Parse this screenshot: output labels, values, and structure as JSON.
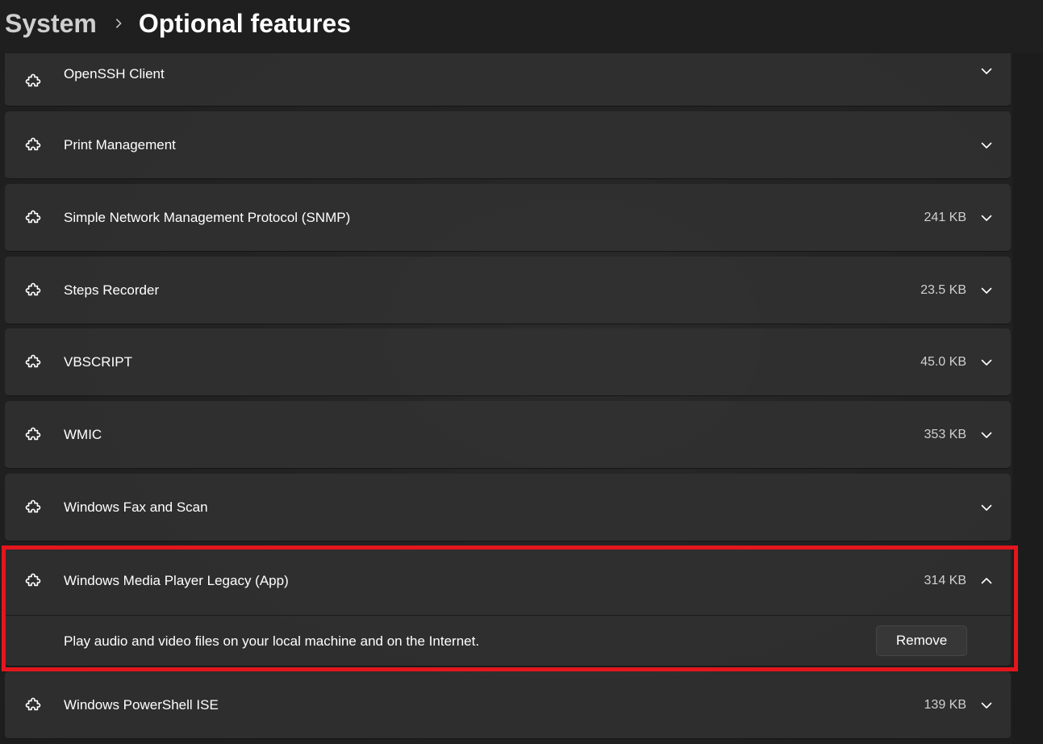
{
  "breadcrumb": {
    "parent": "System",
    "current": "Optional features"
  },
  "icons": {
    "feature": "puzzle-piece-icon",
    "expand": "chevron-down-icon",
    "collapse": "chevron-up-icon",
    "separator": "chevron-right-icon"
  },
  "colors": {
    "highlight": "#e3161d",
    "card_background": "#323232",
    "page_background": "#202020"
  },
  "features": [
    {
      "name": "OpenSSH Client",
      "size": "",
      "expanded": false
    },
    {
      "name": "Print Management",
      "size": "",
      "expanded": false
    },
    {
      "name": "Simple Network Management Protocol (SNMP)",
      "size": "241 KB",
      "expanded": false
    },
    {
      "name": "Steps Recorder",
      "size": "23.5 KB",
      "expanded": false
    },
    {
      "name": "VBSCRIPT",
      "size": "45.0 KB",
      "expanded": false
    },
    {
      "name": "WMIC",
      "size": "353 KB",
      "expanded": false
    },
    {
      "name": "Windows Fax and Scan",
      "size": "",
      "expanded": false
    },
    {
      "name": "Windows Media Player Legacy (App)",
      "size": "314 KB",
      "expanded": true,
      "description": "Play audio and video files on your local machine and on the Internet.",
      "action_label": "Remove"
    },
    {
      "name": "Windows PowerShell ISE",
      "size": "139 KB",
      "expanded": false
    }
  ]
}
